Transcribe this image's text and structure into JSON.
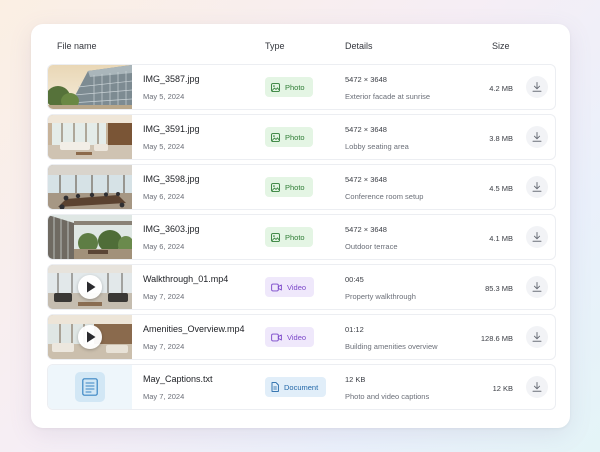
{
  "header": {
    "file_name": "File name",
    "type": "Type",
    "details": "Details",
    "size": "Size"
  },
  "colors": {
    "photo_badge_bg": "#e4f5e4",
    "photo_badge_text": "#2e7d35",
    "video_badge_bg": "#efe8fb",
    "video_badge_text": "#7a46c9",
    "document_badge_bg": "#e1eef9",
    "document_badge_text": "#2267a8"
  },
  "files": [
    {
      "name": "IMG_3587.jpg",
      "date": "May 5, 2024",
      "type": "Photo",
      "type_icon": "image-icon",
      "details_main": "5472 × 3648",
      "details_sub": "Exterior facade at sunrise",
      "size": "4.2 MB"
    },
    {
      "name": "IMG_3591.jpg",
      "date": "May 5, 2024",
      "type": "Photo",
      "type_icon": "image-icon",
      "details_main": "5472 × 3648",
      "details_sub": "Lobby seating area",
      "size": "3.8 MB"
    },
    {
      "name": "IMG_3598.jpg",
      "date": "May 6, 2024",
      "type": "Photo",
      "type_icon": "image-icon",
      "details_main": "5472 × 3648",
      "details_sub": "Conference room setup",
      "size": "4.5 MB"
    },
    {
      "name": "IMG_3603.jpg",
      "date": "May 6, 2024",
      "type": "Photo",
      "type_icon": "image-icon",
      "details_main": "5472 × 3648",
      "details_sub": "Outdoor terrace",
      "size": "4.1 MB"
    },
    {
      "name": "Walkthrough_01.mp4",
      "date": "May 7, 2024",
      "type": "Video",
      "type_icon": "video-camera-icon",
      "details_main": "00:45",
      "details_sub": "Property walkthrough",
      "size": "85.3 MB"
    },
    {
      "name": "Amenities_Overview.mp4",
      "date": "May 7, 2024",
      "type": "Video",
      "type_icon": "video-camera-icon",
      "details_main": "01:12",
      "details_sub": "Building amenities overview",
      "size": "128.6 MB"
    },
    {
      "name": "May_Captions.txt",
      "date": "May 7, 2024",
      "type": "Document",
      "type_icon": "document-icon",
      "details_main": "12 KB",
      "details_sub": "Photo and video captions",
      "size": "12 KB"
    }
  ]
}
